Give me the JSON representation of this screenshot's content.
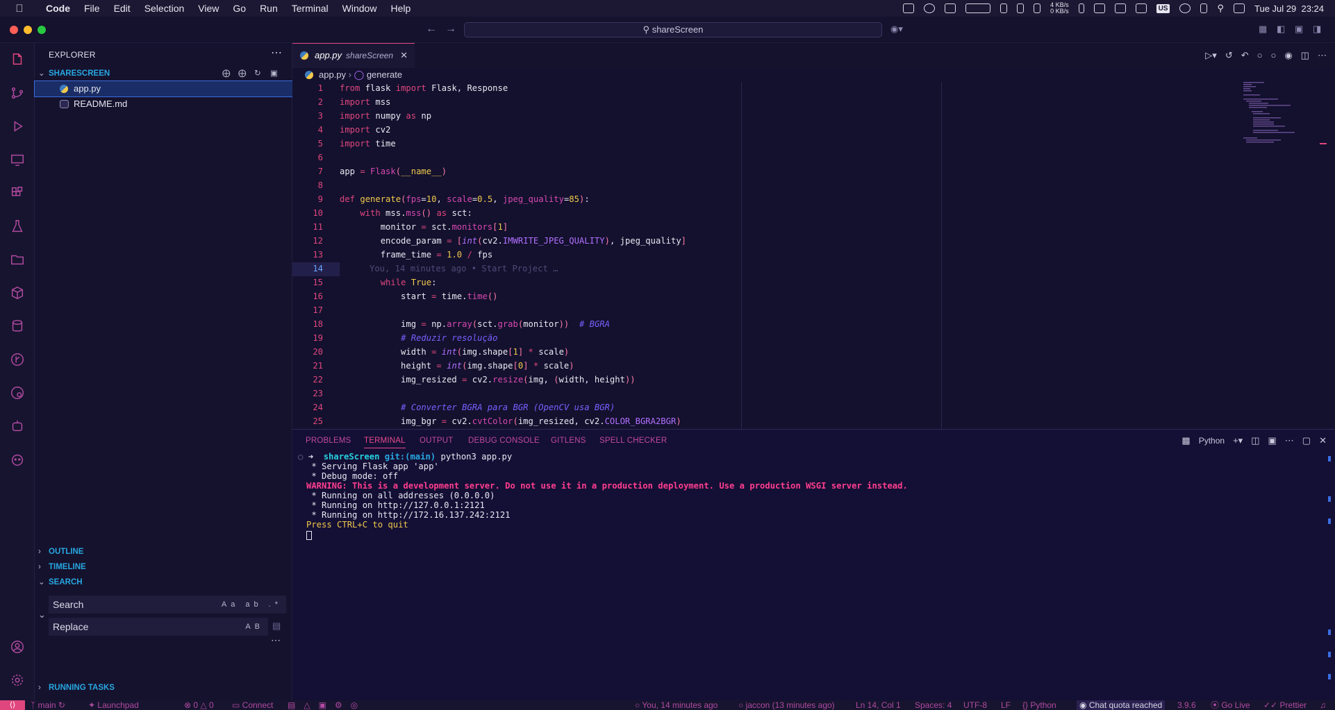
{
  "menubar": {
    "app": "Code",
    "items": [
      "File",
      "Edit",
      "Selection",
      "View",
      "Go",
      "Run",
      "Terminal",
      "Window",
      "Help"
    ],
    "net_up": "4 KB/s",
    "net_down": "0 KB/s",
    "input_source": "US",
    "datetime": "Tue Jul 29  23:24"
  },
  "titlebar": {
    "search": "shareScreen"
  },
  "sidebar": {
    "title": "EXPLORER",
    "project": "SHARESCREEN",
    "files": [
      "app.py",
      "README.md"
    ],
    "outline": "OUTLINE",
    "timeline": "TIMELINE",
    "search_header": "SEARCH",
    "search_placeholder": "Search",
    "replace_placeholder": "Replace",
    "search_opts": "Aa ab .*",
    "replace_opts": "AB",
    "running_tasks": "RUNNING TASKS"
  },
  "editor": {
    "tab_name": "app.py",
    "tab_folder": "shareScreen",
    "breadcrumb_file": "app.py",
    "breadcrumb_symbol": "generate",
    "current_line": 14,
    "blame": "You, 14 minutes ago • Start Project …",
    "line_numbers": [
      "1",
      "2",
      "3",
      "4",
      "5",
      "6",
      "7",
      "8",
      "9",
      "10",
      "11",
      "12",
      "13",
      "14",
      "15",
      "16",
      "17",
      "18",
      "19",
      "20",
      "21",
      "22",
      "23",
      "24",
      "25"
    ]
  },
  "panel": {
    "tabs": [
      "PROBLEMS",
      "TERMINAL",
      "OUTPUT",
      "DEBUG CONSOLE",
      "GITLENS",
      "SPELL CHECKER"
    ],
    "active_tab": "TERMINAL",
    "shell": "Python",
    "prompt_dir": "shareScreen",
    "prompt_git": "git:(main)",
    "command": "python3 app.py",
    "output": [
      " * Serving Flask app 'app'",
      " * Debug mode: off"
    ],
    "warning": "WARNING: This is a development server. Do not use it in a production deployment. Use a production WSGI server instead.",
    "running": [
      " * Running on all addresses (0.0.0.0)",
      " * Running on http://127.0.0.1:2121",
      " * Running on http://172.16.137.242:2121"
    ],
    "quit_msg": "Press CTRL+C to quit"
  },
  "statusbar": {
    "branch": "main",
    "launchpad": "Launchpad",
    "errors": "0",
    "warnings": "0",
    "connect": "Connect",
    "blame": "You, 14 minutes ago",
    "author": "jaccon (13 minutes ago)",
    "position": "Ln 14, Col 1",
    "spaces": "Spaces: 4",
    "encoding": "UTF-8",
    "eol": "LF",
    "language": "Python",
    "chat": "Chat quota reached",
    "py_version": "3.9.6",
    "golive": "Go Live",
    "prettier": "Prettier"
  },
  "colors": {
    "accent": "#e0467e",
    "keyword": "#e0467e",
    "function": "#d948b0",
    "number": "#f2c94c",
    "comment": "#7b5fff",
    "header": "#27a7e0"
  }
}
